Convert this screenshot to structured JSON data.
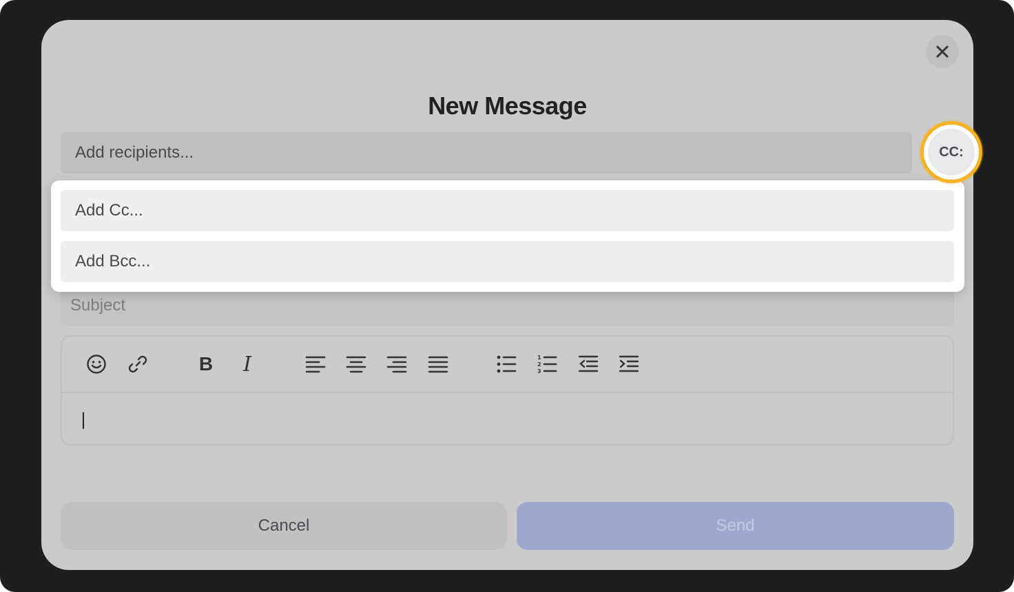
{
  "dialog": {
    "title": "New Message",
    "recipients_placeholder": "Add recipients...",
    "cc_toggle_label": "CC:",
    "cc_placeholder": "Add Cc...",
    "bcc_placeholder": "Add Bcc...",
    "subject_placeholder": "Subject"
  },
  "toolbar": {
    "buttons": [
      {
        "icon": "emoji-icon"
      },
      {
        "icon": "link-icon"
      },
      {
        "icon": "bold-icon",
        "label": "B"
      },
      {
        "icon": "italic-icon",
        "label": "I"
      },
      {
        "icon": "align-left-icon"
      },
      {
        "icon": "align-center-icon"
      },
      {
        "icon": "align-right-icon"
      },
      {
        "icon": "align-justify-icon"
      },
      {
        "icon": "bullet-list-icon"
      },
      {
        "icon": "numbered-list-icon"
      },
      {
        "icon": "outdent-icon"
      },
      {
        "icon": "indent-icon"
      }
    ]
  },
  "actions": {
    "cancel_label": "Cancel",
    "send_label": "Send"
  },
  "colors": {
    "highlight": "#f5b324",
    "send_button": "#9ea8cd",
    "modal_background": "#cbcbcb"
  }
}
